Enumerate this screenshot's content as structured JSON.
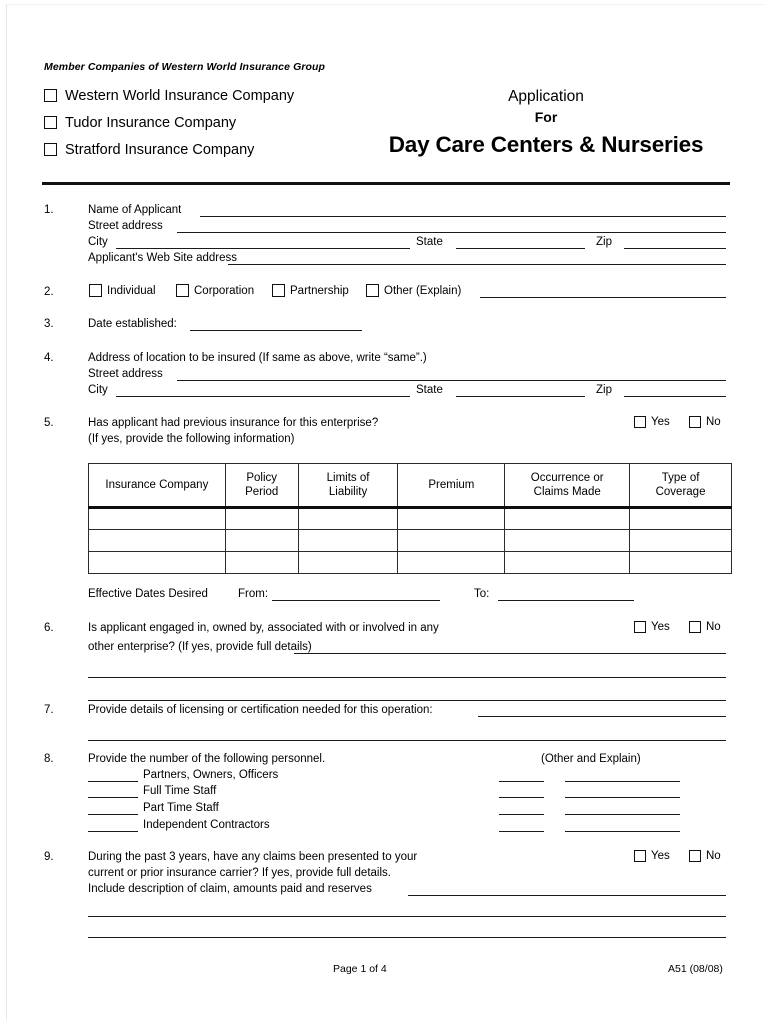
{
  "header": {
    "member_line": "Member Companies of Western World Insurance Group",
    "companies": [
      "Western World Insurance Company",
      "Tudor Insurance Company",
      "Stratford Insurance Company"
    ],
    "title_line1": "Application",
    "title_line2": "For",
    "title_line3": "Day Care Centers & Nurseries"
  },
  "items": {
    "n1": "1.",
    "n2": "2.",
    "n3": "3.",
    "n4": "4.",
    "n5": "5.",
    "n6": "6.",
    "n7": "7.",
    "n8": "8.",
    "n9": "9."
  },
  "q1": {
    "name_of_applicant": "Name of Applicant",
    "street_address": "Street address",
    "city": "City",
    "state": "State",
    "zip": "Zip",
    "web_site": "Applicant's Web Site address"
  },
  "q2": {
    "individual": "Individual",
    "corporation": "Corporation",
    "partnership": "Partnership",
    "other": "Other (Explain)"
  },
  "q3": {
    "date_established": "Date established:"
  },
  "q4": {
    "heading": "Address of location to be insured (If same as above, write “same”.)",
    "street_address": "Street address",
    "city": "City",
    "state": "State",
    "zip": "Zip"
  },
  "q5": {
    "line1": "Has applicant had previous insurance for this enterprise?",
    "line2": "(If yes, provide the following information)",
    "yes": "Yes",
    "no": "No"
  },
  "table": {
    "columns": [
      "Insurance Company",
      "Policy\nPeriod",
      "Limits of\nLiability",
      "Premium",
      "Occurrence or\nClaims Made",
      "Type of\nCoverage"
    ],
    "col1_line1": "Insurance Company",
    "col2_line1": "Policy",
    "col2_line2": "Period",
    "col3_line1": "Limits of",
    "col3_line2": "Liability",
    "col4_line1": "Premium",
    "col5_line1": "Occurrence or",
    "col5_line2": "Claims Made",
    "col6_line1": "Type of",
    "col6_line2": "Coverage",
    "row_count": 3
  },
  "effective": {
    "label": "Effective Dates Desired",
    "from": "From:",
    "to": "To:"
  },
  "q6": {
    "line1": "Is applicant engaged in, owned by, associated with or involved in any",
    "line2": "other enterprise?  (If yes, provide full details)",
    "yes": "Yes",
    "no": "No"
  },
  "q7": {
    "text": "Provide details of licensing or certification needed for this operation:"
  },
  "q8": {
    "heading": "Provide the number of the following personnel.",
    "other_heading": "(Other and Explain)",
    "rows": [
      "Partners, Owners, Officers",
      "Full Time Staff",
      "Part Time Staff",
      "Independent Contractors"
    ]
  },
  "q9": {
    "line1": "During the past 3 years, have any claims been presented to your",
    "line2": "current or prior insurance carrier?  If yes, provide full details.",
    "line3": "Include description of claim, amounts paid and reserves",
    "yes": "Yes",
    "no": "No"
  },
  "footer": {
    "page": "Page 1 of 4",
    "form_code": "A51 (08/08)"
  }
}
